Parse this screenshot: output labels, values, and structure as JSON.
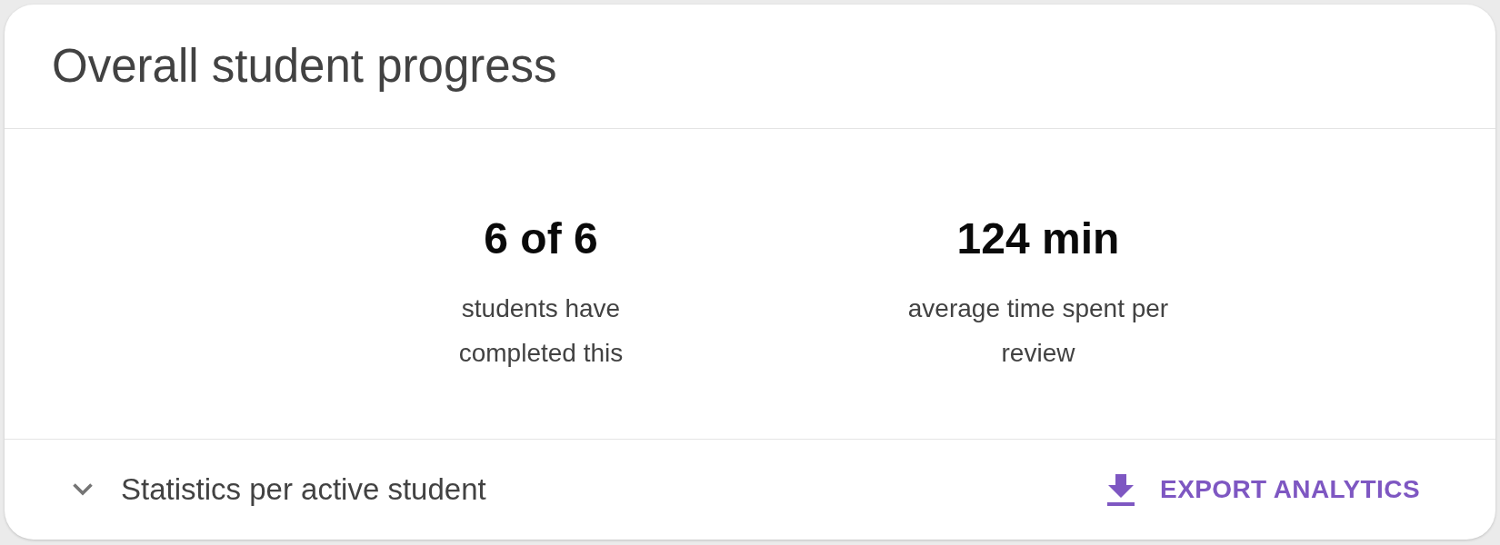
{
  "card": {
    "title": "Overall student progress"
  },
  "stats": [
    {
      "value": "6 of 6",
      "label": "students have completed this"
    },
    {
      "value": "124 min",
      "label": "average time spent per review"
    }
  ],
  "footer": {
    "expander": {
      "label": "Statistics per active student",
      "expanded": false
    },
    "export_button": {
      "label": "EXPORT ANALYTICS"
    }
  }
}
